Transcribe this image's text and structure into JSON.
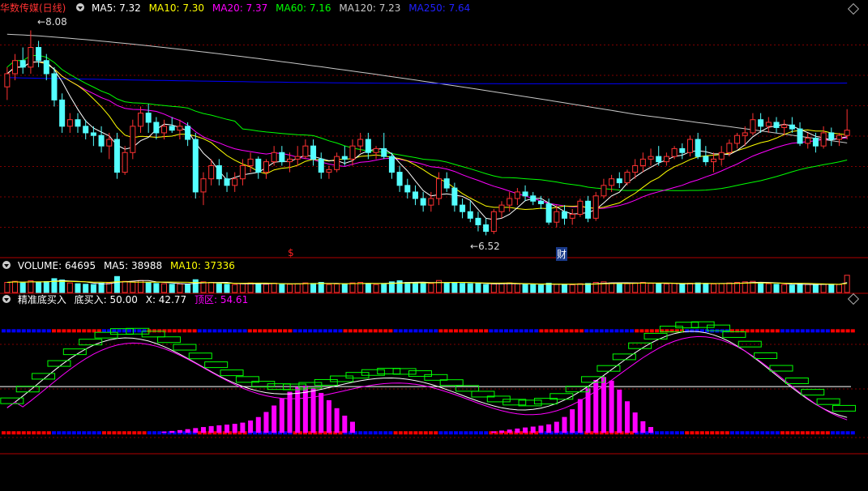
{
  "main": {
    "title": "华数传媒(日线)",
    "ma": [
      {
        "label": "MA5: ",
        "value": "7.32",
        "color": "#ffffff"
      },
      {
        "label": "MA10: ",
        "value": "7.30",
        "color": "#ffff00"
      },
      {
        "label": "MA20: ",
        "value": "7.37",
        "color": "#ff00ff"
      },
      {
        "label": "MA60: ",
        "value": "7.16",
        "color": "#00ff00"
      },
      {
        "label": "MA120: ",
        "value": "7.23",
        "color": "#c8c8c8"
      },
      {
        "label": "MA250: ",
        "value": "7.64",
        "color": "#0000ff"
      }
    ],
    "high_label": "8.08",
    "low_label": "6.52",
    "marker_s": "$",
    "marker_cai": "财"
  },
  "volume": {
    "title": "VOLUME: ",
    "value": "64695",
    "ma5_label": "MA5: ",
    "ma5_value": "38988",
    "ma10_label": "MA10: ",
    "ma10_value": "37336"
  },
  "indicator": {
    "title": "精准底买入",
    "buy_label": "底买入: ",
    "buy_value": "50.00",
    "x_label": "X: ",
    "x_value": "42.77",
    "top_label": "顶区: ",
    "top_value": "54.61"
  },
  "colors": {
    "up": "#ff3232",
    "down": "#54ffff",
    "grid": "#800000",
    "ma5": "#ffffff",
    "ma10": "#ffff00",
    "ma20": "#ff00ff",
    "ma60": "#00ff00",
    "ma120": "#c8c8c8",
    "ma250": "#0000ff",
    "histogram": "#ff00ff",
    "boxes": "#00ff00",
    "band_red": "#ff0000",
    "band_blue": "#0000ff"
  },
  "chart_data": {
    "type": "candlestick",
    "ylim": [
      6.35,
      8.2
    ],
    "candles": [
      [
        7.65,
        7.8,
        7.55,
        7.75
      ],
      [
        7.75,
        7.9,
        7.7,
        7.85
      ],
      [
        7.85,
        7.95,
        7.75,
        7.8
      ],
      [
        7.8,
        8.08,
        7.75,
        7.95
      ],
      [
        7.95,
        8.0,
        7.8,
        7.85
      ],
      [
        7.85,
        7.9,
        7.7,
        7.75
      ],
      [
        7.75,
        7.8,
        7.5,
        7.55
      ],
      [
        7.55,
        7.6,
        7.3,
        7.35
      ],
      [
        7.35,
        7.45,
        7.3,
        7.4
      ],
      [
        7.4,
        7.45,
        7.3,
        7.35
      ],
      [
        7.35,
        7.4,
        7.25,
        7.3
      ],
      [
        7.3,
        7.35,
        7.2,
        7.28
      ],
      [
        7.28,
        7.35,
        7.15,
        7.2
      ],
      [
        7.2,
        7.3,
        7.1,
        7.25
      ],
      [
        7.25,
        7.3,
        6.95,
        7.0
      ],
      [
        7.0,
        7.2,
        6.98,
        7.15
      ],
      [
        7.15,
        7.4,
        7.1,
        7.35
      ],
      [
        7.35,
        7.5,
        7.3,
        7.45
      ],
      [
        7.45,
        7.52,
        7.3,
        7.38
      ],
      [
        7.38,
        7.42,
        7.25,
        7.3
      ],
      [
        7.3,
        7.4,
        7.25,
        7.35
      ],
      [
        7.35,
        7.42,
        7.3,
        7.32
      ],
      [
        7.32,
        7.4,
        7.25,
        7.35
      ],
      [
        7.35,
        7.38,
        7.2,
        7.25
      ],
      [
        7.25,
        7.3,
        6.8,
        6.85
      ],
      [
        6.85,
        7.0,
        6.75,
        6.95
      ],
      [
        6.95,
        7.1,
        6.9,
        7.05
      ],
      [
        7.05,
        7.1,
        6.9,
        6.95
      ],
      [
        6.95,
        7.0,
        6.85,
        6.9
      ],
      [
        6.9,
        7.0,
        6.85,
        6.95
      ],
      [
        6.95,
        7.1,
        6.9,
        7.05
      ],
      [
        7.05,
        7.15,
        7.0,
        7.1
      ],
      [
        7.1,
        7.12,
        6.95,
        7.0
      ],
      [
        7.0,
        7.1,
        6.95,
        7.08
      ],
      [
        7.08,
        7.2,
        7.05,
        7.15
      ],
      [
        7.15,
        7.2,
        7.05,
        7.08
      ],
      [
        7.08,
        7.15,
        7.0,
        7.1
      ],
      [
        7.1,
        7.2,
        7.05,
        7.12
      ],
      [
        7.12,
        7.25,
        7.1,
        7.2
      ],
      [
        7.2,
        7.25,
        7.05,
        7.1
      ],
      [
        7.1,
        7.15,
        6.95,
        7.0
      ],
      [
        7.0,
        7.05,
        6.95,
        7.02
      ],
      [
        7.02,
        7.15,
        7.0,
        7.12
      ],
      [
        7.12,
        7.2,
        7.05,
        7.1
      ],
      [
        7.1,
        7.25,
        7.05,
        7.2
      ],
      [
        7.2,
        7.3,
        7.15,
        7.25
      ],
      [
        7.25,
        7.3,
        7.1,
        7.15
      ],
      [
        7.15,
        7.2,
        7.1,
        7.18
      ],
      [
        7.18,
        7.3,
        7.1,
        7.12
      ],
      [
        7.12,
        7.15,
        6.95,
        7.0
      ],
      [
        7.0,
        7.05,
        6.85,
        6.9
      ],
      [
        6.9,
        6.95,
        6.8,
        6.85
      ],
      [
        6.85,
        6.9,
        6.75,
        6.8
      ],
      [
        6.8,
        6.85,
        6.7,
        6.75
      ],
      [
        6.75,
        6.85,
        6.7,
        6.8
      ],
      [
        6.8,
        7.0,
        6.75,
        6.95
      ],
      [
        6.95,
        7.0,
        6.85,
        6.88
      ],
      [
        6.88,
        6.92,
        6.7,
        6.75
      ],
      [
        6.75,
        6.8,
        6.65,
        6.7
      ],
      [
        6.7,
        6.78,
        6.62,
        6.65
      ],
      [
        6.65,
        6.7,
        6.55,
        6.6
      ],
      [
        6.6,
        6.65,
        6.52,
        6.55
      ],
      [
        6.55,
        6.72,
        6.53,
        6.7
      ],
      [
        6.7,
        6.78,
        6.65,
        6.75
      ],
      [
        6.75,
        6.85,
        6.7,
        6.8
      ],
      [
        6.8,
        6.88,
        6.75,
        6.85
      ],
      [
        6.85,
        6.9,
        6.78,
        6.82
      ],
      [
        6.82,
        6.85,
        6.75,
        6.78
      ],
      [
        6.78,
        6.82,
        6.72,
        6.76
      ],
      [
        6.76,
        6.8,
        6.6,
        6.62
      ],
      [
        6.62,
        6.75,
        6.58,
        6.7
      ],
      [
        6.7,
        6.75,
        6.6,
        6.65
      ],
      [
        6.65,
        6.72,
        6.6,
        6.68
      ],
      [
        6.68,
        6.8,
        6.66,
        6.78
      ],
      [
        6.78,
        6.82,
        6.62,
        6.65
      ],
      [
        6.65,
        6.85,
        6.63,
        6.82
      ],
      [
        6.82,
        6.95,
        6.8,
        6.9
      ],
      [
        6.9,
        6.98,
        6.85,
        6.95
      ],
      [
        6.95,
        7.0,
        6.88,
        6.92
      ],
      [
        6.92,
        7.02,
        6.9,
        7.0
      ],
      [
        7.0,
        7.1,
        6.95,
        7.05
      ],
      [
        7.05,
        7.15,
        7.0,
        7.1
      ],
      [
        7.1,
        7.18,
        7.05,
        7.12
      ],
      [
        7.12,
        7.2,
        7.05,
        7.08
      ],
      [
        7.08,
        7.15,
        7.05,
        7.12
      ],
      [
        7.12,
        7.2,
        7.1,
        7.18
      ],
      [
        7.18,
        7.22,
        7.1,
        7.15
      ],
      [
        7.15,
        7.28,
        7.12,
        7.25
      ],
      [
        7.25,
        7.3,
        7.1,
        7.12
      ],
      [
        7.12,
        7.2,
        7.05,
        7.08
      ],
      [
        7.08,
        7.15,
        7.0,
        7.1
      ],
      [
        7.1,
        7.2,
        7.05,
        7.15
      ],
      [
        7.15,
        7.25,
        7.12,
        7.22
      ],
      [
        7.22,
        7.3,
        7.18,
        7.28
      ],
      [
        7.28,
        7.35,
        7.2,
        7.3
      ],
      [
        7.3,
        7.45,
        7.28,
        7.4
      ],
      [
        7.4,
        7.45,
        7.3,
        7.35
      ],
      [
        7.35,
        7.42,
        7.3,
        7.38
      ],
      [
        7.38,
        7.42,
        7.3,
        7.34
      ],
      [
        7.34,
        7.4,
        7.28,
        7.36
      ],
      [
        7.36,
        7.42,
        7.3,
        7.33
      ],
      [
        7.33,
        7.38,
        7.2,
        7.22
      ],
      [
        7.22,
        7.3,
        7.18,
        7.26
      ],
      [
        7.26,
        7.3,
        7.15,
        7.2
      ],
      [
        7.2,
        7.35,
        7.18,
        7.3
      ],
      [
        7.3,
        7.34,
        7.2,
        7.25
      ],
      [
        7.25,
        7.3,
        7.2,
        7.28
      ],
      [
        7.28,
        7.48,
        7.25,
        7.32
      ]
    ],
    "volume_ylim": [
      0,
      70000
    ],
    "volume": [
      38000,
      42000,
      36000,
      44000,
      39000,
      41000,
      52000,
      47000,
      36000,
      33000,
      31000,
      30000,
      35000,
      36000,
      60000,
      42000,
      40000,
      45000,
      38000,
      34000,
      33000,
      31000,
      32000,
      30000,
      48000,
      40000,
      38000,
      33000,
      31000,
      30000,
      33000,
      36000,
      34000,
      31000,
      35000,
      32000,
      31000,
      33000,
      36000,
      34000,
      38000,
      30000,
      32000,
      31000,
      36000,
      38000,
      34000,
      30000,
      33000,
      40000,
      44000,
      38000,
      36000,
      35000,
      34000,
      45000,
      37000,
      38000,
      34000,
      33000,
      36000,
      30000,
      32000,
      34000,
      36000,
      33000,
      30000,
      29000,
      28000,
      35000,
      31000,
      30000,
      29000,
      33000,
      34000,
      38000,
      40000,
      36000,
      35000,
      33000,
      36000,
      38000,
      34000,
      33000,
      32000,
      34000,
      31000,
      35000,
      36000,
      34000,
      32000,
      33000,
      36000,
      38000,
      40000,
      42000,
      36000,
      33000,
      31000,
      30000,
      28000,
      33000,
      30000,
      29000,
      32000,
      31000,
      30000,
      64695
    ],
    "indicator_ylim": [
      0,
      120
    ],
    "buy_level": 50.0,
    "top_level": 54.61,
    "last_x": 42.77
  }
}
